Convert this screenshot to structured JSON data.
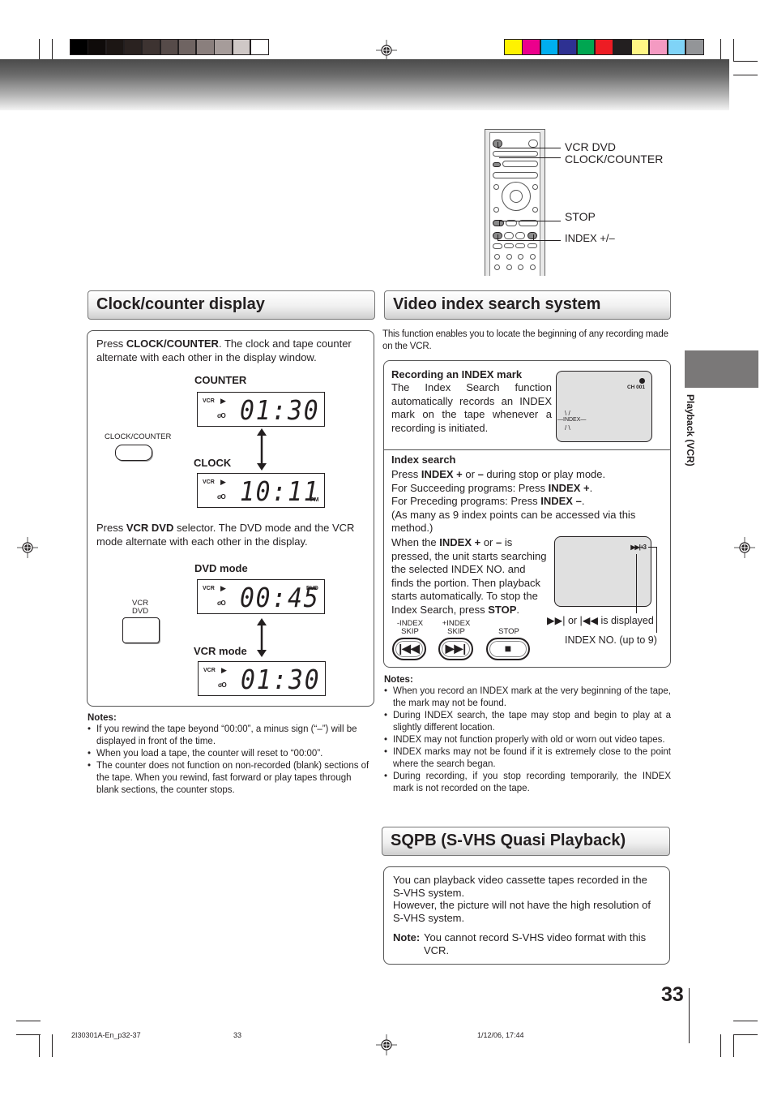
{
  "printers_marks": {
    "gray_swatches": [
      "#000000",
      "#0f0b0a",
      "#1c1614",
      "#2a2220",
      "#3d3331",
      "#564b49",
      "#6f6462",
      "#8a7f7d",
      "#a69c9a",
      "#cfc8c6",
      "#ffffff"
    ],
    "color_swatches": [
      "#fff200",
      "#ec008c",
      "#00aeef",
      "#2e3192",
      "#00a651",
      "#ed1c24",
      "#231f20",
      "#fff685",
      "#f49ac2",
      "#7fd3f7",
      "#939598"
    ]
  },
  "remote": {
    "labels": {
      "vcr_dvd": "VCR DVD",
      "clock_counter": "CLOCK/COUNTER",
      "stop": "STOP",
      "index": "INDEX +/–"
    }
  },
  "side_tab": {
    "label": "Playback (VCR)",
    "color": "#7a7878"
  },
  "clock_section": {
    "title": "Clock/counter display",
    "intro_prefix": "Press ",
    "intro_bold": "CLOCK/COUNTER",
    "intro_suffix": ". The clock and tape counter alternate with each other in the display window.",
    "button_label": "CLOCK/COUNTER",
    "counter_label": "COUNTER",
    "counter_display": {
      "vcr": "VCR",
      "play": "▶",
      "tape": "σO",
      "digits": "01:30"
    },
    "clock_label": "CLOCK",
    "clock_display": {
      "vcr": "VCR",
      "play": "▶",
      "tape": "σO",
      "digits": "10:11",
      "suffix": "PM"
    },
    "vcrdvd_prefix": "Press ",
    "vcrdvd_bold": "VCR DVD",
    "vcrdvd_suffix": " selector. The DVD mode and the VCR mode alternate with each other in the display.",
    "vcrdvd_button_label_1": "VCR",
    "vcrdvd_button_label_2": "DVD",
    "dvd_mode_label": "DVD mode",
    "dvd_display": {
      "vcr": "VCR",
      "play": "▶",
      "tape": "σO",
      "digits": "00:45",
      "suffix": "DVD"
    },
    "vcr_mode_label": "VCR mode",
    "vcr_display": {
      "vcr": "VCR",
      "play": "▶",
      "tape": "σO",
      "digits": "01:30"
    },
    "notes_title": "Notes:",
    "notes": [
      "If you rewind the tape beyond “00:00”, a minus sign (“–”) will be displayed in front of the time.",
      "When you load a tape, the counter will reset to “00:00”.",
      "The counter does not function on non-recorded (blank) sections of the tape. When you rewind, fast forward or play tapes through blank sections, the counter stops."
    ]
  },
  "index_section": {
    "title": "Video index search system",
    "intro": "This function enables you to locate the beginning of any recording made on the VCR.",
    "recording_title": "Recording an INDEX mark",
    "recording_text": "The Index Search function automatically records an INDEX mark on the tape whenever a recording is initiated.",
    "screen1": {
      "channel": "CH 001",
      "index_label": "INDEX"
    },
    "search_title": "Index search",
    "search_lines": [
      {
        "pre": "Press ",
        "b1": "INDEX +",
        "mid": " or ",
        "b2": "–",
        "post": " during stop or play mode."
      },
      {
        "pre": "For Succeeding programs: Press ",
        "b1": "INDEX +",
        "mid": "",
        "b2": "",
        "post": "."
      },
      {
        "pre": "For Preceding programs: Press ",
        "b1": "INDEX –",
        "mid": "",
        "b2": "",
        "post": "."
      }
    ],
    "search_paren": "(As many as 9 index points can be accessed via this method.)",
    "when_pre": "When the ",
    "when_b1": "INDEX +",
    "when_mid": " or ",
    "when_b2": "–",
    "when_post": " is pressed, the unit starts searching the selected INDEX NO. and finds the portion. Then playback starts automatically. To stop the Index Search, press ",
    "when_b3": "STOP",
    "when_end": ".",
    "screen2": {
      "indicator": "▶▶|+3"
    },
    "callout_displayed": "▶▶| or |◀◀ is displayed",
    "callout_index_no": "INDEX NO. (up to 9)",
    "buttons": [
      {
        "label_1": "-INDEX",
        "label_2": "SKIP",
        "glyph": "|◀◀"
      },
      {
        "label_1": "+INDEX",
        "label_2": "SKIP",
        "glyph": "▶▶|"
      },
      {
        "label_1": "",
        "label_2": "STOP",
        "glyph": "■"
      }
    ],
    "notes_title": "Notes:",
    "notes": [
      "When you record an INDEX mark at the very beginning of the tape, the mark may not be found.",
      "During INDEX search, the tape may stop and begin to play at a slightly different location.",
      "INDEX may not function properly with old or worn out video tapes.",
      "INDEX marks may not be found if it is extremely close to the point where the search began.",
      "During recording, if you stop recording temporarily, the INDEX mark is not recorded on the tape."
    ]
  },
  "sqpb_section": {
    "title": "SQPB (S-VHS Quasi Playback)",
    "para1": "You can playback video cassette tapes recorded in the S-VHS system.",
    "para2": "However, the picture will not have the high resolution of S-VHS system.",
    "note_label": "Note:",
    "note_text": "You cannot record S-VHS video format with this VCR."
  },
  "page_number": "33",
  "footer": {
    "file": "2I30301A-En_p32-37",
    "page": "33",
    "datetime": "1/12/06, 17:44"
  }
}
